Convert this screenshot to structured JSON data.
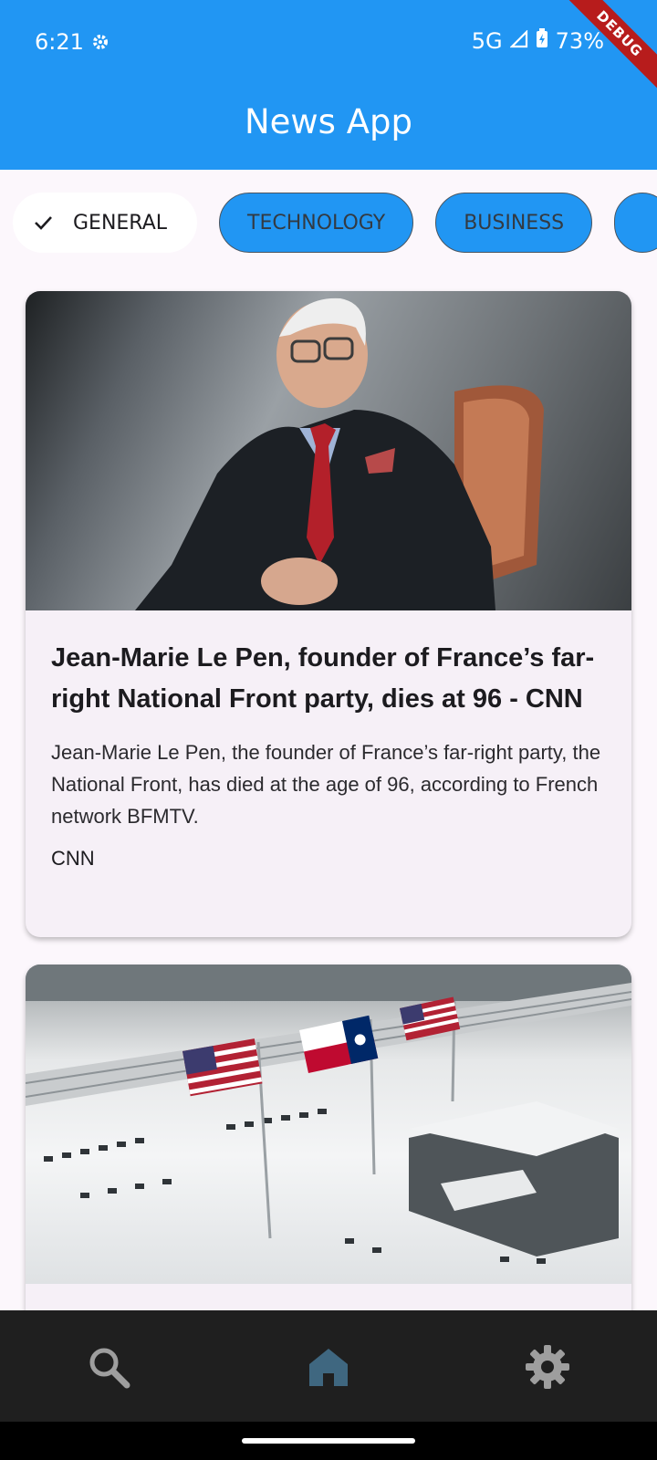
{
  "status_bar": {
    "time": "6:21",
    "network": "5G",
    "battery": "73%",
    "debug_banner": "DEBUG"
  },
  "app_bar": {
    "title": "News App"
  },
  "categories": [
    {
      "label": "GENERAL",
      "selected": true
    },
    {
      "label": "TECHNOLOGY",
      "selected": false
    },
    {
      "label": "BUSINESS",
      "selected": false
    }
  ],
  "articles": [
    {
      "title": "Jean-Marie Le Pen, founder of France’s far-right National Front party, dies at 96 - CNN",
      "description": "Jean-Marie Le Pen, the founder of France’s far-right party, the National Front, has died at the age of 96, according to French network BFMTV.",
      "source": "CNN"
    }
  ],
  "bottom_nav": {
    "items": [
      "search-icon",
      "home-icon",
      "settings-icon"
    ],
    "active": "home-icon"
  },
  "colors": {
    "primary": "#2196f3",
    "background": "#fcf7fc",
    "card": "#f6f0f7",
    "nav_background": "#1f1f1f",
    "nav_active": "#3f6780",
    "nav_inactive": "#9e9e9e"
  }
}
